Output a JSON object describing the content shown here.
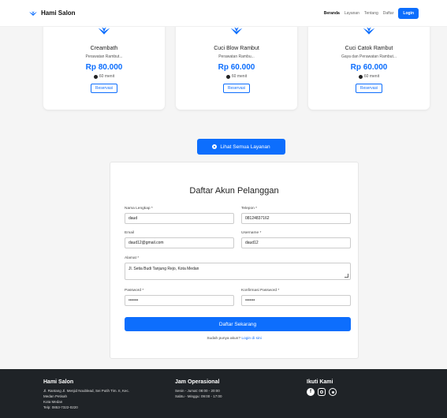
{
  "navbar": {
    "brand": "Hami Salon",
    "links": [
      "Beranda",
      "Layanan",
      "Tentang",
      "Daftar"
    ],
    "login": "Login",
    "brand_color": "#0d6efd"
  },
  "services": {
    "cards": [
      {
        "title": "Creambath",
        "desc": "Perawatan Rambut...",
        "price": "Rp 80.000",
        "duration": "60 menit",
        "button": "Reservasi"
      },
      {
        "title": "Cuci Blow Rambut",
        "desc": "Perawatan Rambu...",
        "price": "Rp 60.000",
        "duration": "60 menit",
        "button": "Reservasi"
      },
      {
        "title": "Cuci Catok Rambut",
        "desc": "Gaya dan Perawatan Rambut...",
        "price": "Rp 60.000",
        "duration": "60 menit",
        "button": "Reservasi"
      }
    ],
    "see_all": "Lihat Semua Layanan"
  },
  "register": {
    "title": "Daftar Akun Pelanggan",
    "fields": {
      "nama": {
        "label": "Nama Lengkap *",
        "value": "daud"
      },
      "telepon": {
        "label": "Telepon *",
        "value": "08124837162"
      },
      "email": {
        "label": "Email",
        "value": "daud12@gmail.com"
      },
      "username": {
        "label": "Username *",
        "value": "daud12"
      },
      "alamat": {
        "label": "Alamat *",
        "value": "Jl. Setia Budi Tanjung Rejo, Kota Medan"
      },
      "password": {
        "label": "Password *",
        "value": "•••••••"
      },
      "konfirmasi": {
        "label": "Konfirmasi Password *",
        "value": "•••••••"
      }
    },
    "submit": "Daftar Sekarang",
    "hint_text": "Sudah punya akun?",
    "hint_link": "Login di sini"
  },
  "footer": {
    "col1": {
      "title": "Hami Salon",
      "lines": [
        "Jl. Rantang Jl. Menjid Noublead, Sei Putih Tim. II, Kec.",
        "Medan Petisah",
        "Kota Medan",
        "Telp: 0853-7322-0220"
      ]
    },
    "col2": {
      "title": "Jam Operasional",
      "lines": [
        "Senin - Jumat: 08:00 - 20:00",
        "Sabtu - Minggu: 09:00 - 17:00"
      ]
    },
    "col3": {
      "title": "Ikuti Kami",
      "icons": [
        "facebook-icon",
        "instagram-icon",
        "whatsapp-icon"
      ]
    }
  }
}
